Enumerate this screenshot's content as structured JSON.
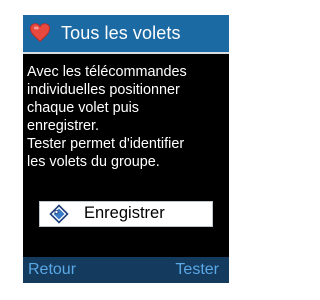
{
  "header": {
    "title": "Tous les volets",
    "icon": "heart-icon",
    "background": "#1c6aa4"
  },
  "message": {
    "lines": [
      "Avec les télécommandes",
      "individuelles positionner",
      "chaque volet puis",
      "enregistrer.",
      "Tester permet d'identifier",
      "les volets du groupe."
    ]
  },
  "record_button": {
    "label": "Enregistrer",
    "icon": "tag-icon"
  },
  "footer": {
    "back_label": "Retour",
    "test_label": "Tester",
    "background": "#143a5d",
    "text_color": "#5aa8e6"
  }
}
